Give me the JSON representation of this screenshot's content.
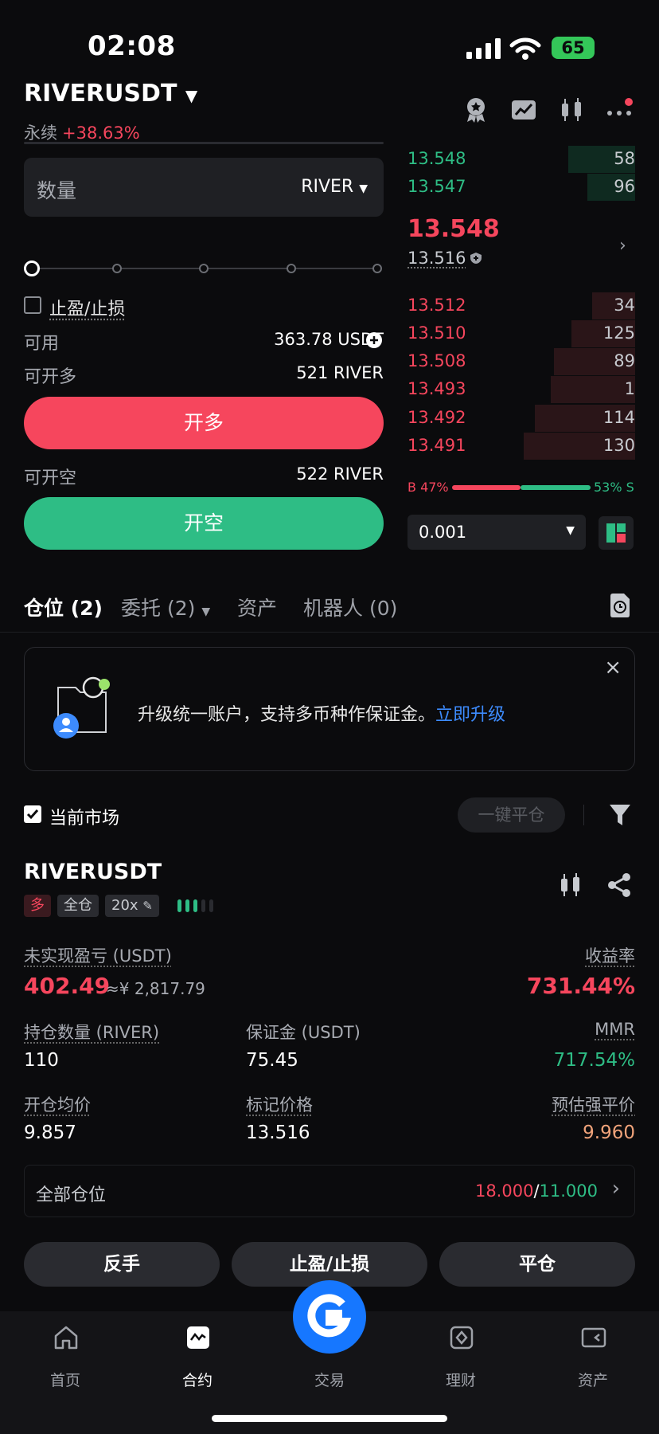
{
  "status_bar": {
    "time": "02:08",
    "battery": "65"
  },
  "header": {
    "pair": "RIVERUSDT",
    "type_label": "永续",
    "change": "+38.63%"
  },
  "order_form": {
    "qty_label": "数量",
    "qty_unit": "RIVER",
    "tp_sl_label": "止盈/止损",
    "available_label": "可用",
    "available_value": "363.78 USDT",
    "max_long_label": "可开多",
    "max_long_value": "521 RIVER",
    "long_button": "开多",
    "max_short_label": "可开空",
    "max_short_value": "522 RIVER",
    "short_button": "开空"
  },
  "orderbook": {
    "asks": [
      {
        "price": "13.548",
        "qty": "58"
      },
      {
        "price": "13.547",
        "qty": "96"
      }
    ],
    "last_price": "13.548",
    "mark_price": "13.516",
    "bids": [
      {
        "price": "13.512",
        "qty": "34"
      },
      {
        "price": "13.510",
        "qty": "125"
      },
      {
        "price": "13.508",
        "qty": "89"
      },
      {
        "price": "13.493",
        "qty": "1"
      },
      {
        "price": "13.492",
        "qty": "114"
      },
      {
        "price": "13.491",
        "qty": "130"
      }
    ],
    "buy_ratio": "B 47%",
    "sell_ratio": "53% S",
    "precision": "0.001"
  },
  "tabs": [
    {
      "label": "仓位 (2)"
    },
    {
      "label": "委托 (2)"
    },
    {
      "label": "资产"
    },
    {
      "label": "机器人 (0)"
    }
  ],
  "banner": {
    "text": "升级统一账户，支持多币种作保证金。",
    "link": "立即升级"
  },
  "filters": {
    "current_market": "当前市场",
    "close_all": "一键平仓"
  },
  "position": {
    "symbol": "RIVERUSDT",
    "side_tag": "多",
    "margin_tag": "全仓",
    "leverage_tag": "20x",
    "pnl_label": "未实现盈亏 (USDT)",
    "pnl_value": "402.49",
    "pnl_cny": "≈¥ 2,817.79",
    "roe_label": "收益率",
    "roe_value": "731.44%",
    "size_label": "持仓数量 (RIVER)",
    "size_value": "110",
    "margin_label": "保证金 (USDT)",
    "margin_value": "75.45",
    "mmr_label": "MMR",
    "mmr_value": "717.54%",
    "entry_label": "开仓均价",
    "entry_value": "9.857",
    "mark_label": "标记价格",
    "mark_value": "13.516",
    "liq_label": "预估强平价",
    "liq_value": "9.960",
    "all_positions_label": "全部仓位",
    "all_positions_red": "18.000",
    "all_positions_sep": "/",
    "all_positions_green": "11.000"
  },
  "actions": {
    "reverse": "反手",
    "tp_sl": "止盈/止损",
    "close": "平仓"
  },
  "nav": [
    {
      "label": "首页",
      "icon": "home-icon"
    },
    {
      "label": "合约",
      "icon": "futures-icon"
    },
    {
      "label": "交易",
      "icon": "trade-icon"
    },
    {
      "label": "理财",
      "icon": "earn-icon"
    },
    {
      "label": "资产",
      "icon": "wallet-icon"
    }
  ],
  "colors": {
    "red": "#f6465d",
    "green": "#2ebd85",
    "blue": "#1677ff"
  }
}
